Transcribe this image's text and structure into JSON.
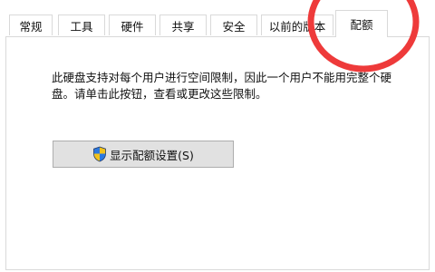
{
  "tabs": [
    {
      "label": "常规"
    },
    {
      "label": "工具"
    },
    {
      "label": "硬件"
    },
    {
      "label": "共享"
    },
    {
      "label": "安全"
    },
    {
      "label": "以前的版本"
    },
    {
      "label": "配额"
    }
  ],
  "active_tab": "配额",
  "quota": {
    "description": "此硬盘支持对每个用户进行空间限制，因此一个用户不能用完整个硬盘。请单击此按钮，查看或更改这些限制。",
    "button_label": "显示配额设置(S)",
    "button_icon": "shield-icon"
  },
  "annotation": {
    "color": "#ee3a3a"
  },
  "colors": {
    "button_bg": "#e1e1e1",
    "border": "#d9d9d9"
  }
}
